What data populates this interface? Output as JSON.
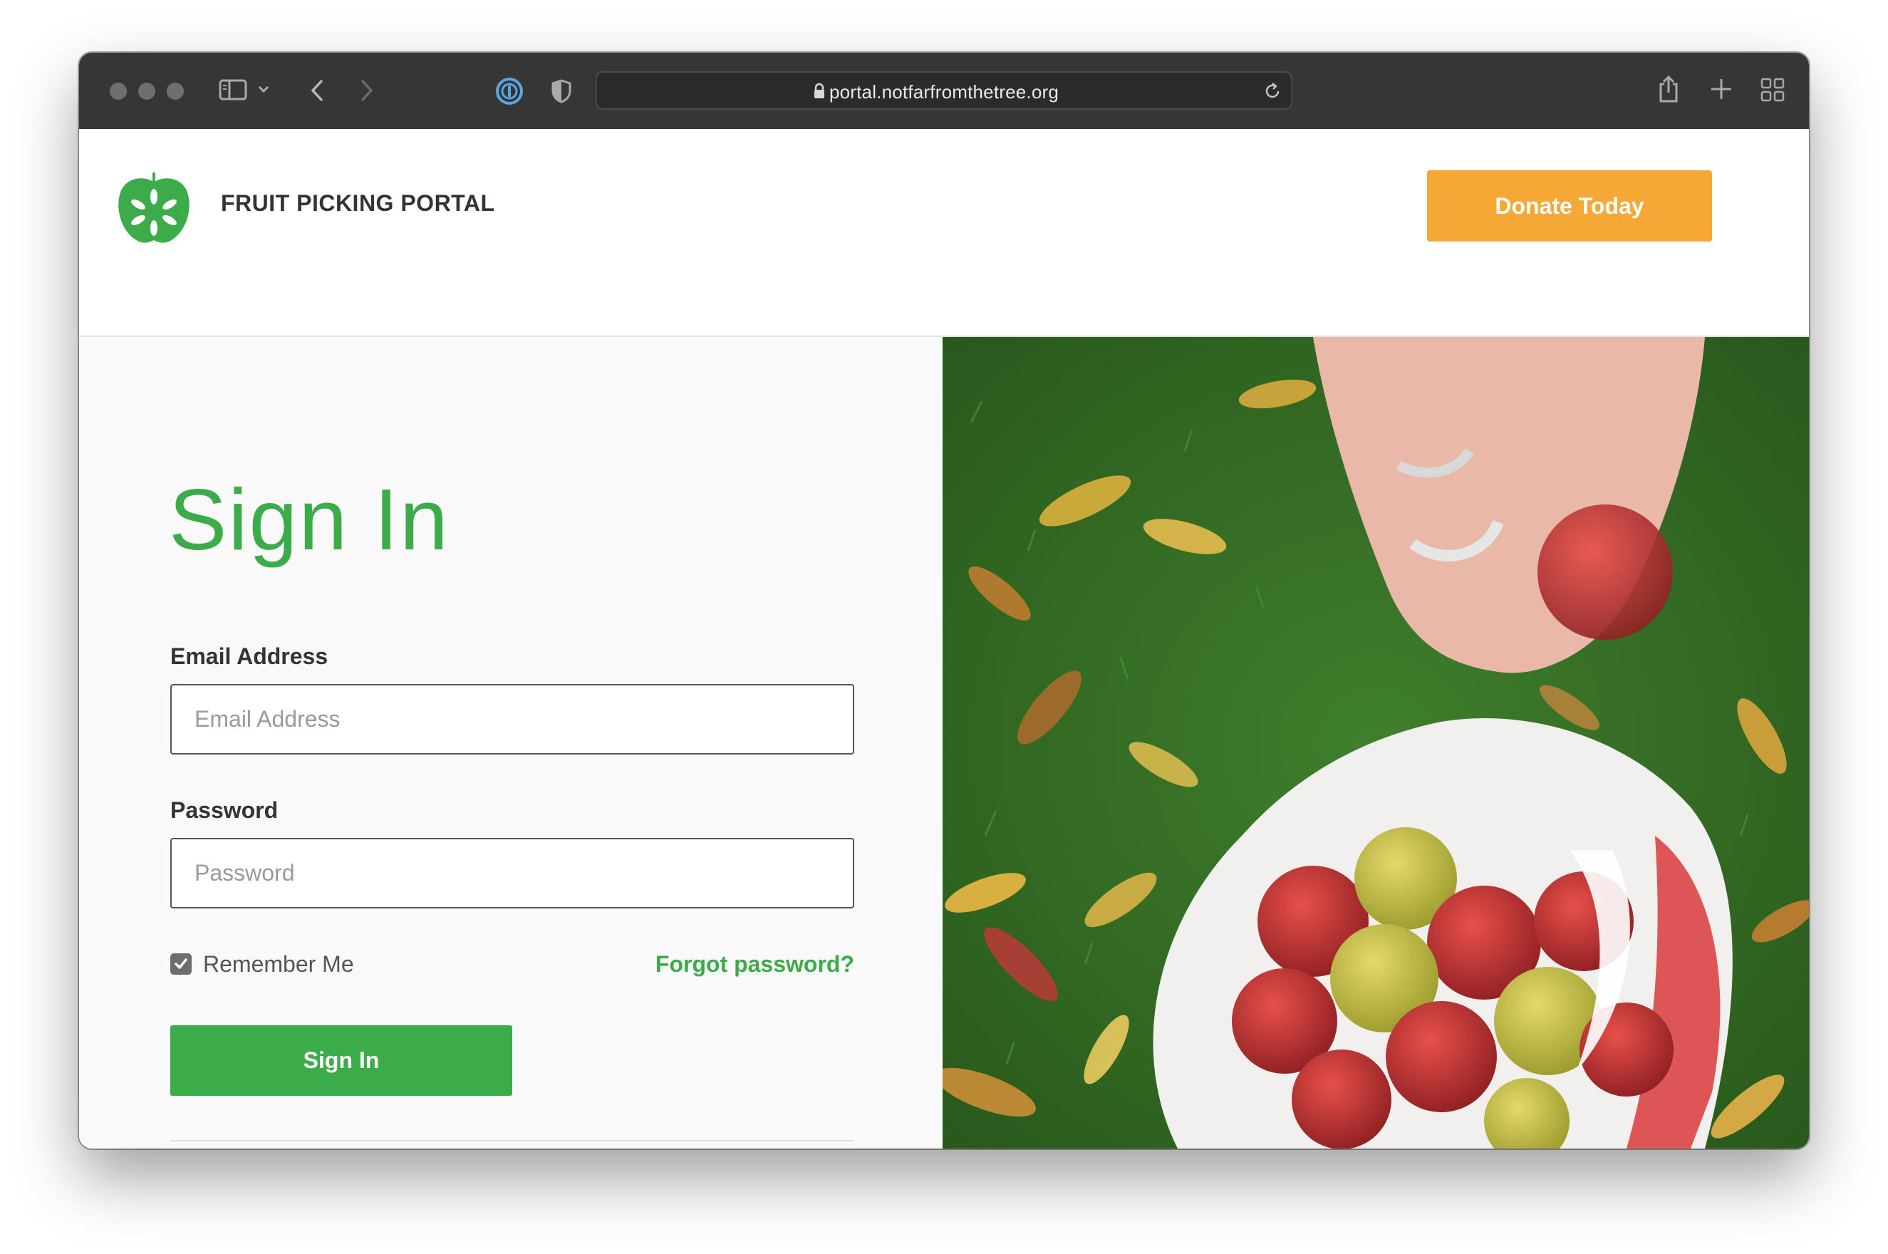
{
  "browser": {
    "url": "portal.notfarfromthetree.org"
  },
  "header": {
    "brand": "FRUIT PICKING PORTAL",
    "donate_label": "Donate Today"
  },
  "signin": {
    "title": "Sign In",
    "email_label": "Email Address",
    "email_placeholder": "Email Address",
    "password_label": "Password",
    "password_placeholder": "Password",
    "remember_label": "Remember Me",
    "remember_checked": true,
    "forgot_label": "Forgot password?",
    "submit_label": "Sign In"
  },
  "colors": {
    "brand_green": "#3cac4a",
    "donate_orange": "#f6a836",
    "toolbar": "#363636"
  },
  "hero_image": {
    "icon": "apple-picking-photo"
  }
}
